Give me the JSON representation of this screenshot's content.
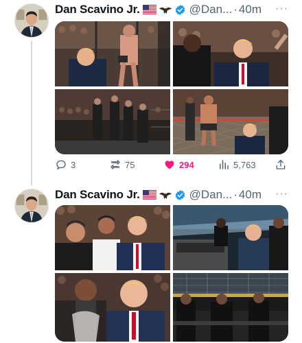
{
  "tweets": [
    {
      "author_name": "Dan Scavino Jr.",
      "handle": "@Dan...",
      "separator": "·",
      "time": "40m",
      "more": "···",
      "badges": [
        "us-flag-icon",
        "eagle-icon",
        "verified-badge-icon"
      ],
      "media": [
        "ufc-octagon-photo-1",
        "ufc-octagon-photo-2",
        "ufc-octagon-photo-3",
        "ufc-octagon-photo-4"
      ],
      "stats": {
        "replies": "3",
        "reposts": "75",
        "likes": "294",
        "views": "5,763"
      },
      "liked": true
    },
    {
      "author_name": "Dan Scavino Jr.",
      "handle": "@Dan...",
      "separator": "·",
      "time": "40m",
      "more": "···",
      "badges": [
        "us-flag-icon",
        "eagle-icon",
        "verified-badge-icon"
      ],
      "media": [
        "crowd-group-photo",
        "arena-seats-photo",
        "crowd-close-photo",
        "octagon-side-photo"
      ]
    }
  ],
  "colors": {
    "like": "#f91880",
    "verified": "#1d9bf0",
    "muted": "#536471",
    "thread_line": "#cfd9de"
  },
  "eagle_glyph": "🦅"
}
